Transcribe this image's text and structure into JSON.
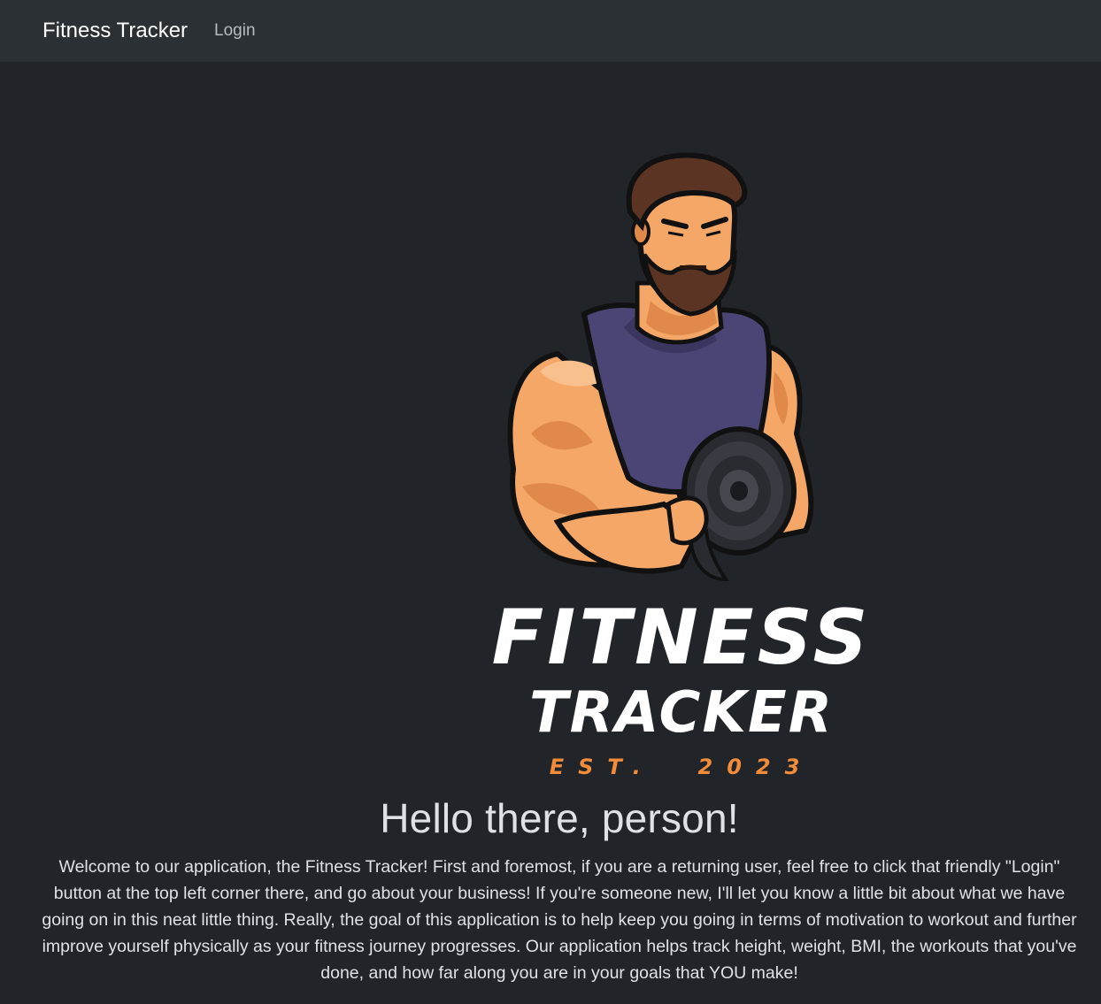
{
  "navbar": {
    "brand": "Fitness Tracker",
    "login_label": "Login"
  },
  "logo": {
    "line1": "FITNESS",
    "line2": "TRACKER",
    "line3": "EST.  2023",
    "accent_color": "#f28c38",
    "shirt_color": "#4a4574"
  },
  "main": {
    "heading": "Hello there, person!",
    "welcome_text": "Welcome to our application, the Fitness Tracker! First and foremost, if you are a returning user, feel free to click that friendly \"Login\" button at the top left corner there, and go about your business! If you're someone new, I'll let you know a little bit about what we have going on in this neat little thing. Really, the goal of this application is to help keep you going in terms of motivation to workout and further improve yourself physically as your fitness journey progresses. Our application helps track height, weight, BMI, the workouts that you've done, and how far along you are in your goals that YOU make!"
  }
}
